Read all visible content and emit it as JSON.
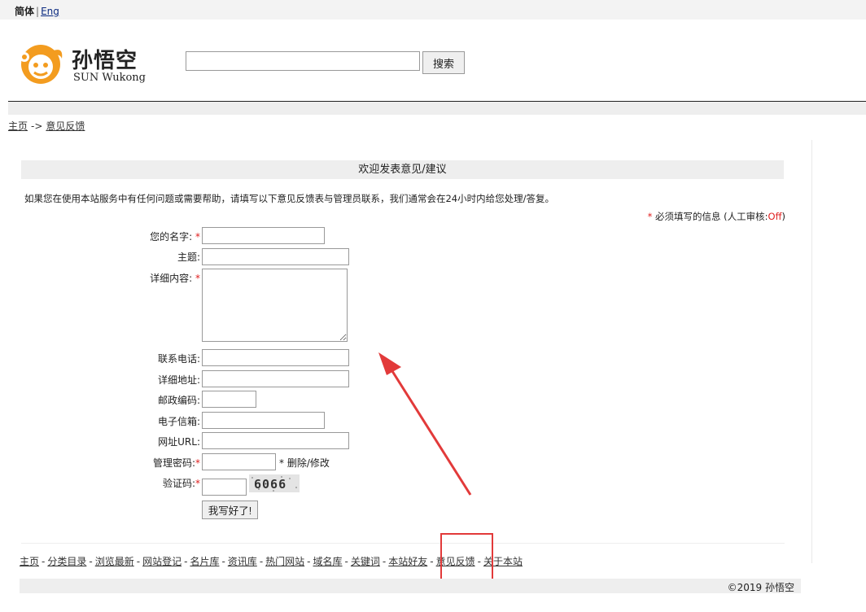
{
  "lang": {
    "current": "简体",
    "separator": "|",
    "other": "Eng"
  },
  "logo": {
    "cn": "孙悟空",
    "en": "SUN Wukong"
  },
  "search": {
    "button": "搜索",
    "value": ""
  },
  "breadcrumb": {
    "home": "主页",
    "arrow": "->",
    "current": "意见反馈"
  },
  "form": {
    "title": "欢迎发表意见/建议",
    "intro": "如果您在使用本站服务中有任何问题或需要帮助，请填写以下意见反馈表与管理员联系，我们通常会在24小时内给您处理/答复。",
    "required_star": "*",
    "required_text": "必须填写的信息",
    "review_prefix": "(人工审核:",
    "review_status": "Off",
    "review_suffix": ")",
    "fields": {
      "name": {
        "label": "您的名字:",
        "required": "*"
      },
      "subject": {
        "label": "主题:"
      },
      "content": {
        "label": "详细内容:",
        "required": "*"
      },
      "phone": {
        "label": "联系电话:"
      },
      "address": {
        "label": "详细地址:"
      },
      "zip": {
        "label": "邮政编码:"
      },
      "email": {
        "label": "电子信箱:"
      },
      "url": {
        "label": "网址URL:"
      },
      "password": {
        "label": "管理密码:",
        "required": "*",
        "note_star": "*",
        "note": "删除/修改"
      },
      "captcha": {
        "label": "验证码:",
        "required": "*",
        "image_text": "6066"
      }
    },
    "submit": "我写好了!"
  },
  "footer": {
    "links": [
      "主页",
      "分类目录",
      "浏览最新",
      "网站登记",
      "名片库",
      "资讯库",
      "热门网站",
      "域名库",
      "关键词",
      "本站好友",
      "意见反馈",
      "关于本站"
    ],
    "separator": "-",
    "copyright": "©2019 孙悟空"
  },
  "colors": {
    "accent": "#f39c1f",
    "required": "#e02020",
    "annotation": "#e23a3a"
  }
}
